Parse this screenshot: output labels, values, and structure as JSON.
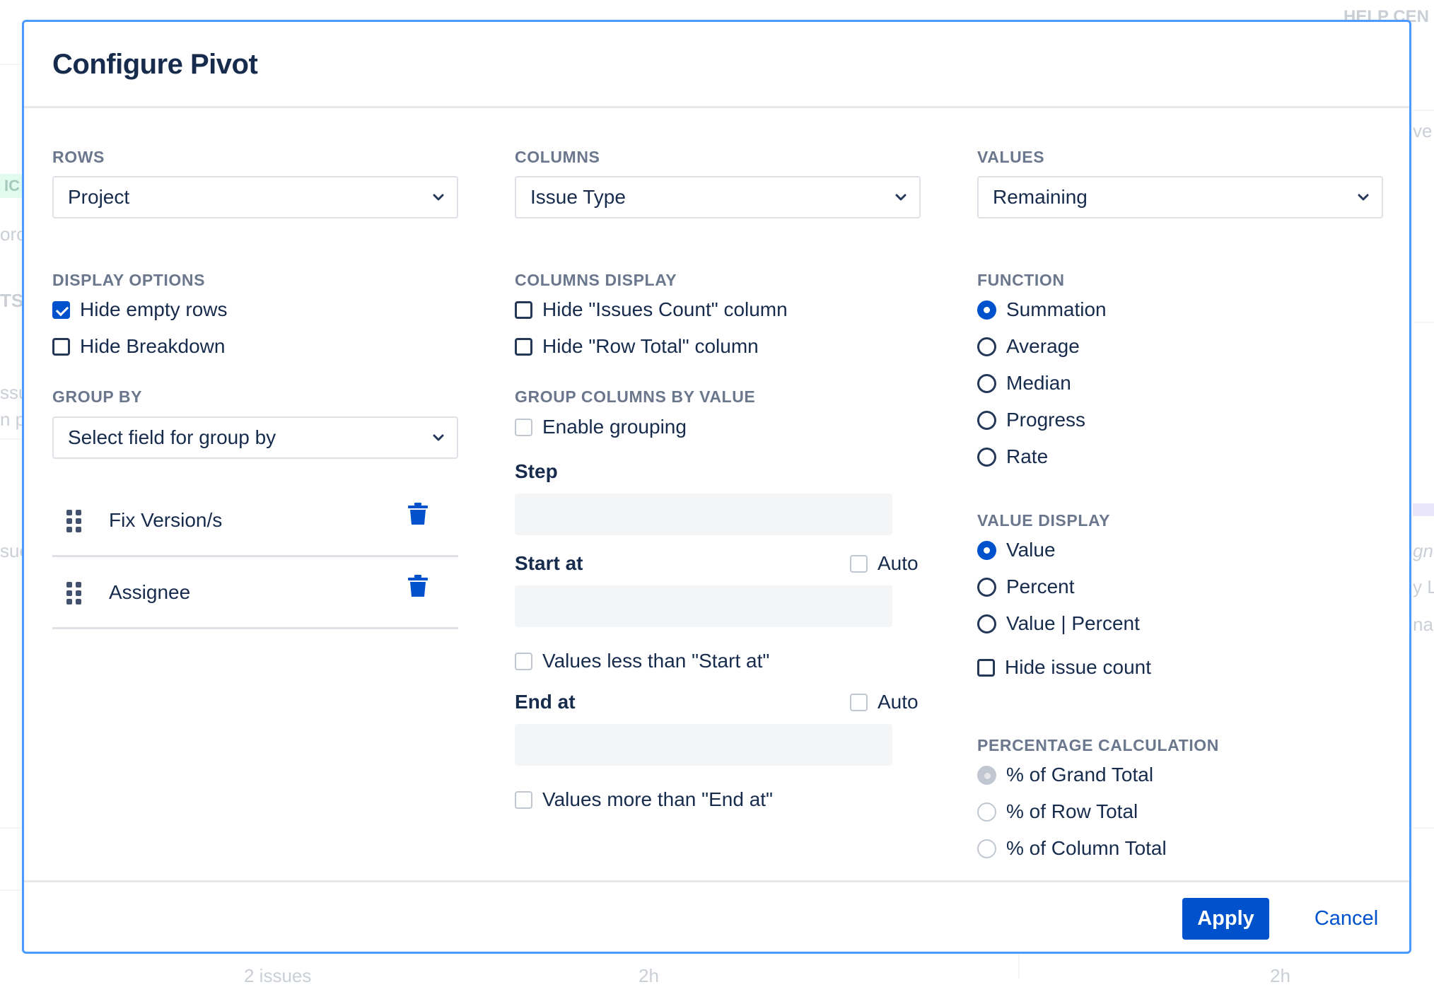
{
  "background": {
    "top_right_text": "HELP CEN",
    "right_text_1": "ve",
    "left_badge": "IC",
    "left_texts": [
      "oro",
      "TS",
      "ssu",
      "n p",
      "sue"
    ],
    "right_texts": [
      "gne",
      "y L",
      "nae"
    ],
    "bottom_texts": [
      "2 issues",
      "2h",
      "2h"
    ]
  },
  "modal": {
    "title": "Configure Pivot",
    "rows": {
      "label": "ROWS",
      "value": "Project"
    },
    "columns": {
      "label": "COLUMNS",
      "value": "Issue Type"
    },
    "values": {
      "label": "VALUES",
      "value": "Remaining"
    },
    "display_options": {
      "label": "DISPLAY OPTIONS",
      "items": [
        {
          "label": "Hide empty rows",
          "checked": true
        },
        {
          "label": "Hide Breakdown",
          "checked": false
        }
      ]
    },
    "group_by": {
      "label": "GROUP BY",
      "placeholder": "Select field for group by",
      "items": [
        {
          "label": "Fix Version/s"
        },
        {
          "label": "Assignee"
        }
      ]
    },
    "columns_display": {
      "label": "COLUMNS DISPLAY",
      "items": [
        {
          "label": "Hide \"Issues Count\" column",
          "checked": false
        },
        {
          "label": "Hide \"Row Total\" column",
          "checked": false
        }
      ]
    },
    "group_columns_by_value": {
      "label": "GROUP COLUMNS BY VALUE",
      "enable_label": "Enable grouping",
      "step_label": "Step",
      "start_label": "Start at",
      "start_auto": "Auto",
      "values_less": "Values less than \"Start at\"",
      "end_label": "End at",
      "end_auto": "Auto",
      "values_more": "Values more than \"End at\""
    },
    "function": {
      "label": "FUNCTION",
      "selected": "Summation",
      "options": [
        "Summation",
        "Average",
        "Median",
        "Progress",
        "Rate"
      ]
    },
    "value_display": {
      "label": "VALUE DISPLAY",
      "selected": "Value",
      "options": [
        "Value",
        "Percent",
        "Value | Percent"
      ],
      "hide_issue_count": "Hide issue count"
    },
    "percentage_calculation": {
      "label": "PERCENTAGE CALCULATION",
      "selected": "% of Grand Total",
      "options": [
        "% of Grand Total",
        "% of Row Total",
        "% of Column Total"
      ]
    },
    "footer": {
      "apply": "Apply",
      "cancel": "Cancel"
    }
  },
  "colors": {
    "primary": "#0052cc",
    "modal_border": "#4c9aff",
    "label_grey": "#6b778c",
    "text": "#172b4d"
  }
}
